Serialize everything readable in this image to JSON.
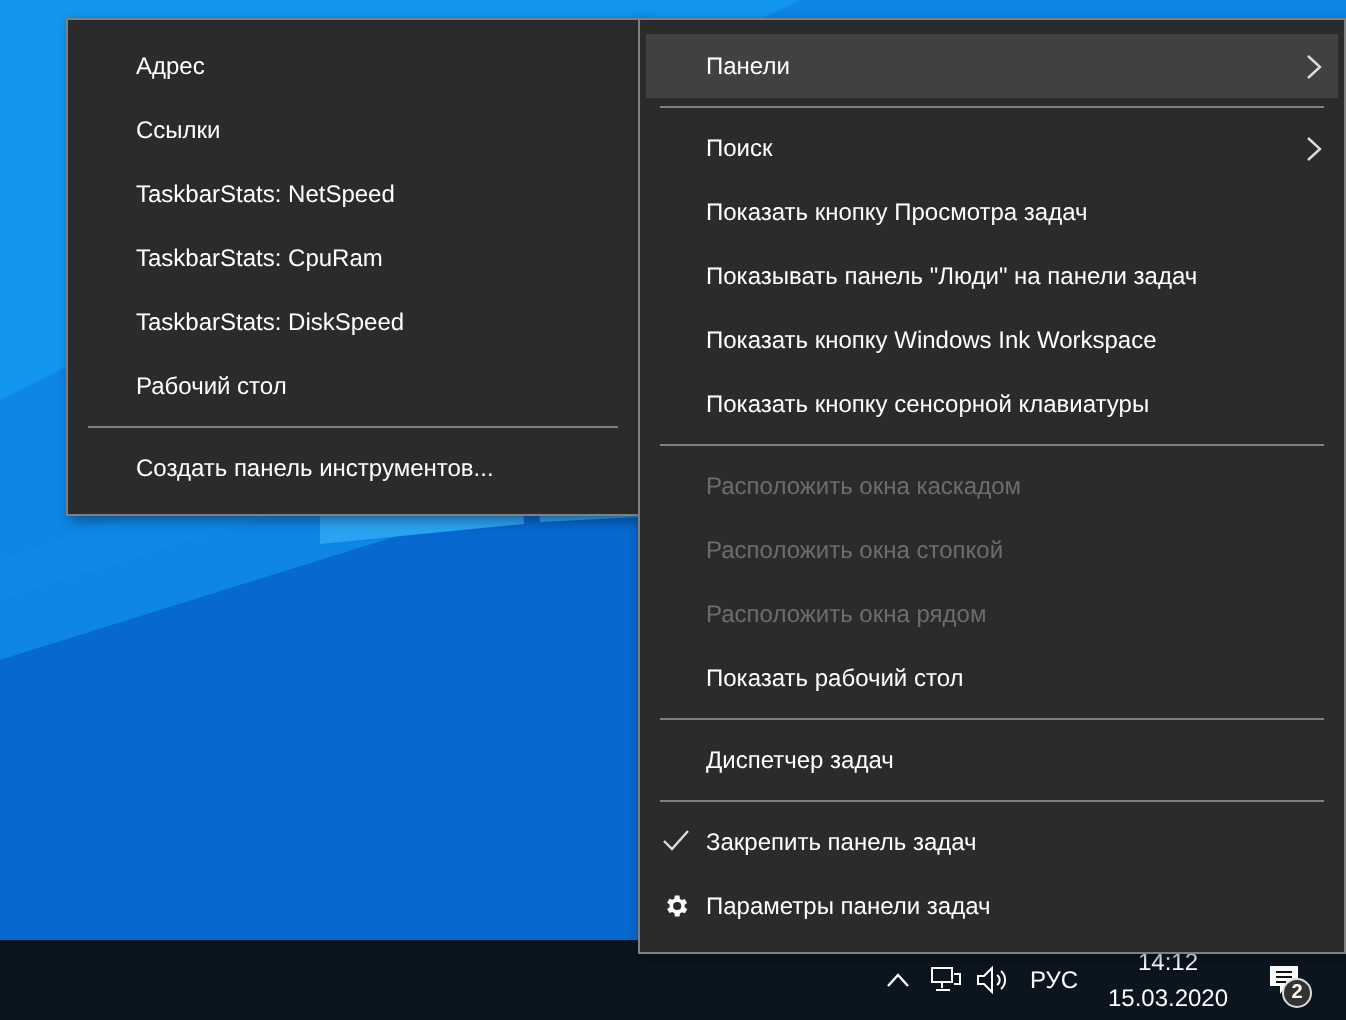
{
  "toolbars_submenu": {
    "items": [
      {
        "kind": "item",
        "label": "Адрес"
      },
      {
        "kind": "item",
        "label": "Ссылки"
      },
      {
        "kind": "item",
        "label": "TaskbarStats: NetSpeed"
      },
      {
        "kind": "item",
        "label": "TaskbarStats: CpuRam"
      },
      {
        "kind": "item",
        "label": "TaskbarStats: DiskSpeed"
      },
      {
        "kind": "item",
        "label": "Рабочий стол"
      },
      {
        "kind": "separator"
      },
      {
        "kind": "item",
        "label": "Создать панель инструментов..."
      }
    ]
  },
  "taskbar_menu": {
    "items": [
      {
        "kind": "submenu",
        "label": "Панели",
        "selected": true,
        "disabled": false
      },
      {
        "kind": "separator"
      },
      {
        "kind": "submenu",
        "label": "Поиск",
        "selected": false,
        "disabled": false
      },
      {
        "kind": "item",
        "label": "Показать кнопку Просмотра задач",
        "selected": false,
        "disabled": false
      },
      {
        "kind": "item",
        "label": "Показывать панель \"Люди\" на панели задач",
        "selected": false,
        "disabled": false
      },
      {
        "kind": "item",
        "label": "Показать кнопку Windows Ink Workspace",
        "selected": false,
        "disabled": false
      },
      {
        "kind": "item",
        "label": "Показать кнопку сенсорной клавиатуры",
        "selected": false,
        "disabled": false
      },
      {
        "kind": "separator"
      },
      {
        "kind": "item",
        "label": "Расположить окна каскадом",
        "selected": false,
        "disabled": true
      },
      {
        "kind": "item",
        "label": "Расположить окна стопкой",
        "selected": false,
        "disabled": true
      },
      {
        "kind": "item",
        "label": "Расположить окна рядом",
        "selected": false,
        "disabled": true
      },
      {
        "kind": "item",
        "label": "Показать рабочий стол",
        "selected": false,
        "disabled": false
      },
      {
        "kind": "separator"
      },
      {
        "kind": "item",
        "label": "Диспетчер задач",
        "selected": false,
        "disabled": false
      },
      {
        "kind": "separator"
      },
      {
        "kind": "check",
        "label": "Закрепить панель задач",
        "checked": true,
        "selected": false,
        "disabled": false
      },
      {
        "kind": "settings",
        "label": "Параметры панели задач",
        "selected": false,
        "disabled": false
      }
    ]
  },
  "taskbar": {
    "language": "РУС",
    "time": "14:12",
    "date": "15.03.2020",
    "notification_count": "2"
  }
}
